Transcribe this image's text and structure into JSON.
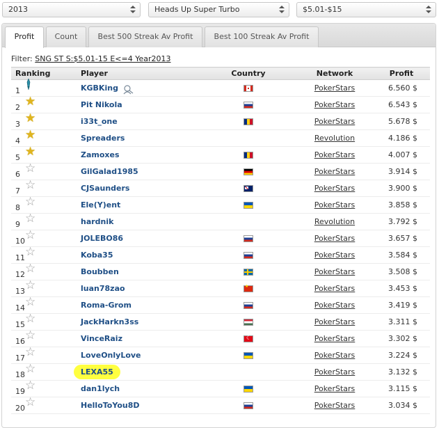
{
  "filters": {
    "year": "2013",
    "game_type": "Heads Up Super Turbo",
    "stakes": "$5.01-$15"
  },
  "tabs": [
    {
      "label": "Profit",
      "active": true
    },
    {
      "label": "Count",
      "active": false
    },
    {
      "label": "Best 500 Streak Av Profit",
      "active": false
    },
    {
      "label": "Best 100 Streak Av Profit",
      "active": false
    }
  ],
  "filter_line": {
    "label": "Filter:",
    "value": "SNG ST S:$5.01-15 E<=4 Year2013"
  },
  "table": {
    "headers": {
      "ranking": "Ranking",
      "player": "Player",
      "country": "Country",
      "network": "Network",
      "profit": "Profit"
    },
    "rows": [
      {
        "rank": "1",
        "player": "KGBKing",
        "country_flag": "ca",
        "network": "PokerStars",
        "profit": "6.560 $",
        "icon": "trophy-icon"
      },
      {
        "rank": "2",
        "player": "Pit Nikola",
        "country_flag": "ru",
        "network": "PokerStars",
        "profit": "6.543 $",
        "icon": "gold-star-icon"
      },
      {
        "rank": "3",
        "player": "i33t_one",
        "country_flag": "ro",
        "network": "PokerStars",
        "profit": "5.678 $",
        "icon": "gold-star-icon"
      },
      {
        "rank": "4",
        "player": "Spreaders",
        "country_flag": "",
        "network": "Revolution",
        "profit": "4.186 $",
        "icon": "gold-star-icon"
      },
      {
        "rank": "5",
        "player": "Zamoxes",
        "country_flag": "ro",
        "network": "PokerStars",
        "profit": "4.007 $",
        "icon": "gold-star-icon"
      },
      {
        "rank": "6",
        "player": "GilGalad1985",
        "country_flag": "de",
        "network": "PokerStars",
        "profit": "3.914 $",
        "icon": "grey-star-icon"
      },
      {
        "rank": "7",
        "player": "CJSaunders",
        "country_flag": "au",
        "network": "PokerStars",
        "profit": "3.900 $",
        "icon": "grey-star-icon"
      },
      {
        "rank": "8",
        "player": "Ele(Y)ent",
        "country_flag": "ua",
        "network": "PokerStars",
        "profit": "3.858 $",
        "icon": "grey-star-icon"
      },
      {
        "rank": "9",
        "player": "hardnik",
        "country_flag": "",
        "network": "Revolution",
        "profit": "3.792 $",
        "icon": "grey-star-icon"
      },
      {
        "rank": "10",
        "player": "JOLEBO86",
        "country_flag": "ru",
        "network": "PokerStars",
        "profit": "3.657 $",
        "icon": "grey-star-icon"
      },
      {
        "rank": "11",
        "player": "Koba35",
        "country_flag": "ru",
        "network": "PokerStars",
        "profit": "3.584 $",
        "icon": "grey-star-icon"
      },
      {
        "rank": "12",
        "player": "Boubben",
        "country_flag": "se",
        "network": "PokerStars",
        "profit": "3.508 $",
        "icon": "grey-star-icon"
      },
      {
        "rank": "13",
        "player": "luan78zao",
        "country_flag": "cn",
        "network": "PokerStars",
        "profit": "3.453 $",
        "icon": "grey-star-icon"
      },
      {
        "rank": "14",
        "player": "Roma-Grom",
        "country_flag": "ru",
        "network": "PokerStars",
        "profit": "3.419 $",
        "icon": "grey-star-icon"
      },
      {
        "rank": "15",
        "player": "JackHarkn3ss",
        "country_flag": "hu",
        "network": "PokerStars",
        "profit": "3.311 $",
        "icon": "grey-star-icon"
      },
      {
        "rank": "16",
        "player": "VinceRaiz",
        "country_flag": "tr",
        "network": "PokerStars",
        "profit": "3.302 $",
        "icon": "grey-star-icon"
      },
      {
        "rank": "17",
        "player": "LoveOnlyLove",
        "country_flag": "ua",
        "network": "PokerStars",
        "profit": "3.224 $",
        "icon": "grey-star-icon"
      },
      {
        "rank": "18",
        "player": "LEXA55",
        "country_flag": "",
        "network": "PokerStars",
        "profit": "3.132 $",
        "icon": "grey-star-icon",
        "highlighted": true
      },
      {
        "rank": "19",
        "player": "dan1lych",
        "country_flag": "ua",
        "network": "PokerStars",
        "profit": "3.115 $",
        "icon": "grey-star-icon"
      },
      {
        "rank": "20",
        "player": "HelloToYou8D",
        "country_flag": "ru",
        "network": "PokerStars",
        "profit": "3.034 $",
        "icon": "grey-star-icon"
      }
    ]
  },
  "colors": {
    "player_link": "#1f4f86",
    "highlight": "#ffff40",
    "gold_star": "#e0b51e"
  }
}
